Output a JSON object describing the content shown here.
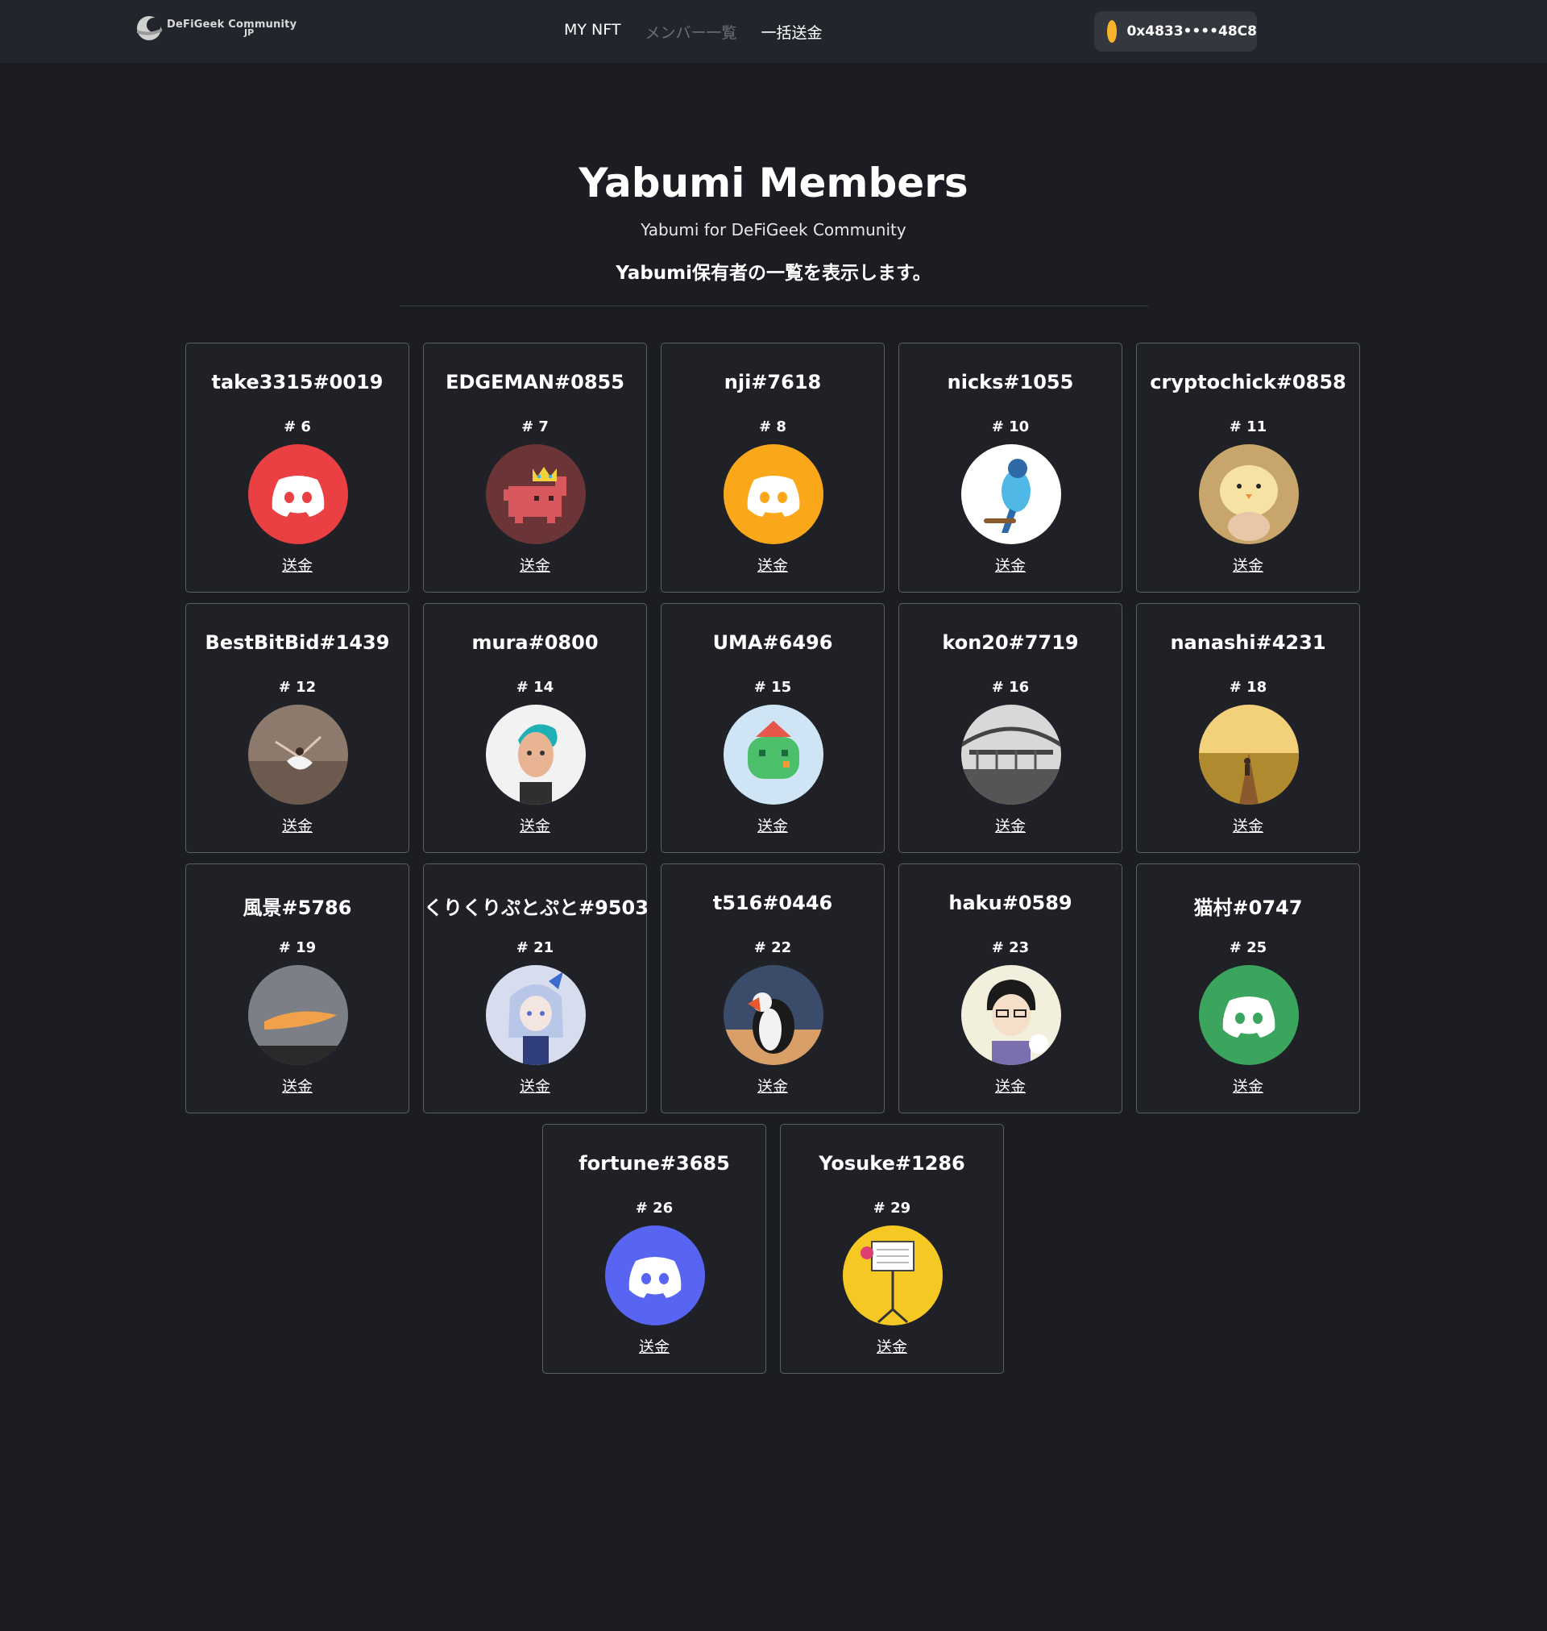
{
  "header": {
    "logo_line1": "DeFiGeek Community",
    "logo_line2": "JP",
    "nav": [
      {
        "label": "MY NFT"
      },
      {
        "label": "メンバー一覧"
      },
      {
        "label": "一括送金"
      }
    ],
    "wallet_address": "0x4833••••48C8"
  },
  "hero": {
    "title": "Yabumi Members",
    "subtitle": "Yabumi for DeFiGeek Community",
    "description": "Yabumi保有者の一覧を表示します。"
  },
  "members": [
    {
      "name": "take3315#0019",
      "id": "# 6",
      "send": "送金",
      "avatar": "discord-icon",
      "color": "#ea3f43"
    },
    {
      "name": "EDGEMAN#0855",
      "id": "# 7",
      "send": "送金",
      "avatar": "pixel-cat-crown-icon",
      "color": "#6b3537"
    },
    {
      "name": "nji#7618",
      "id": "# 8",
      "send": "送金",
      "avatar": "discord-icon",
      "color": "#faa81a"
    },
    {
      "name": "nicks#1055",
      "id": "# 10",
      "send": "送金",
      "avatar": "parakeet-icon",
      "color": "#ffffff"
    },
    {
      "name": "cryptochick#0858",
      "id": "# 11",
      "send": "送金",
      "avatar": "chick-icon",
      "color": "#c8a56a"
    },
    {
      "name": "BestBitBid#1439",
      "id": "# 12",
      "send": "送金",
      "avatar": "ballerina-icon",
      "color": "#8e7a6c"
    },
    {
      "name": "mura#0800",
      "id": "# 14",
      "send": "送金",
      "avatar": "3d-person-icon",
      "color": "#f2f2f2"
    },
    {
      "name": "UMA#6496",
      "id": "# 15",
      "send": "送金",
      "avatar": "pixel-creature-icon",
      "color": "#cfe5f5"
    },
    {
      "name": "kon20#7719",
      "id": "# 16",
      "send": "送金",
      "avatar": "bridge-icon",
      "color": "#9a9a9a"
    },
    {
      "name": "nanashi#4231",
      "id": "# 18",
      "send": "送金",
      "avatar": "sunset-path-icon",
      "color": "#b08a2e"
    },
    {
      "name": "風景#5786",
      "id": "# 19",
      "send": "送金",
      "avatar": "sky-icon",
      "color": "#7d7f86"
    },
    {
      "name": "くりくりぷとぷと#9503",
      "id": "# 21",
      "send": "送金",
      "avatar": "anime-girl-icon",
      "color": "#d7dcef"
    },
    {
      "name": "t516#0446",
      "id": "# 22",
      "send": "送金",
      "avatar": "puffin-icon",
      "color": "#3a4c6a"
    },
    {
      "name": "haku#0589",
      "id": "# 23",
      "send": "送金",
      "avatar": "anime-boy-icon",
      "color": "#f2f0dc"
    },
    {
      "name": "猫村#0747",
      "id": "# 25",
      "send": "送金",
      "avatar": "discord-icon",
      "color": "#3ba55d"
    },
    {
      "name": "fortune#3685",
      "id": "# 26",
      "send": "送金",
      "avatar": "discord-icon",
      "color": "#5865f2"
    },
    {
      "name": "Yosuke#1286",
      "id": "# 29",
      "send": "送金",
      "avatar": "music-stand-icon",
      "color": "#f5c823"
    }
  ]
}
